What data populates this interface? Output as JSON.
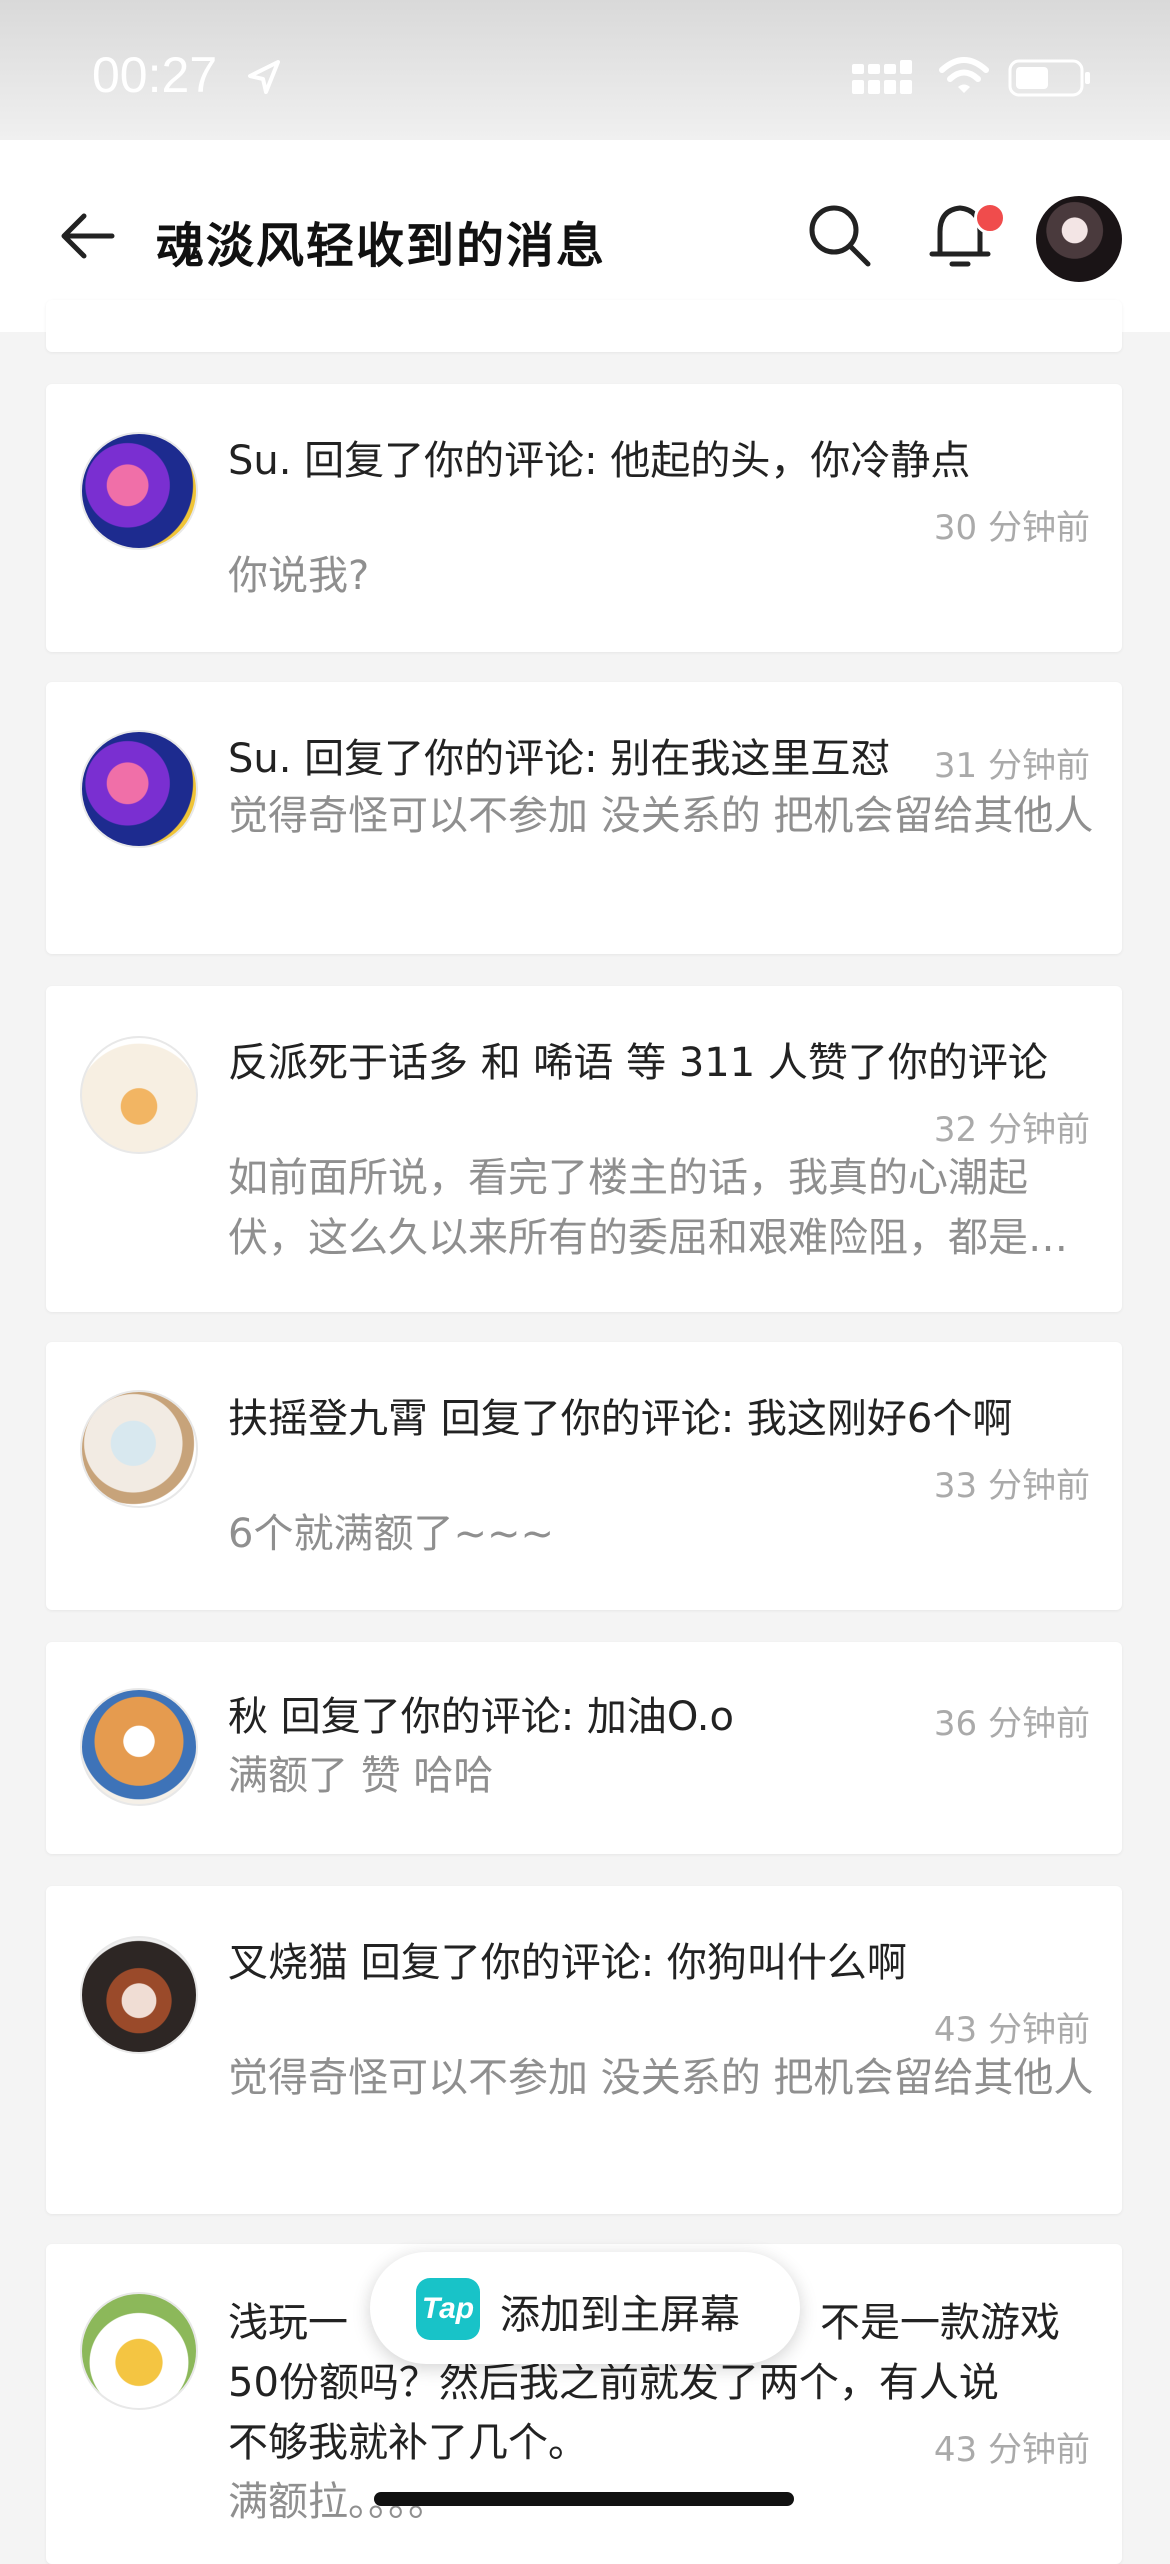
{
  "status_bar": {
    "time": "00:27"
  },
  "header": {
    "title": "魂淡风轻收到的消息"
  },
  "messages": [
    {
      "title": "Su. 回复了你的评论: 他起的头，你冷静点",
      "time": "30 分钟前",
      "body": "你说我?"
    },
    {
      "title": "Su. 回复了你的评论: 别在我这里互怼",
      "time": "31 分钟前",
      "body": "觉得奇怪可以不参加 没关系的 把机会留给其他人"
    },
    {
      "title": "反派死于话多 和 唏语 等 311 人赞了你的评论",
      "time": "32 分钟前",
      "body": "如前面所说，看完了楼主的话，我真的心潮起伏，这么久以来所有的委屈和艰难险阻，都是值得的"
    },
    {
      "title": "扶摇登九霄 回复了你的评论: 我这刚好6个啊",
      "time": "33 分钟前",
      "body": "6个就满额了~~~"
    },
    {
      "title": "秋 回复了你的评论: 加油O.o",
      "time": "36 分钟前",
      "body": "满额了 赞 哈哈"
    },
    {
      "title": "叉烧猫 回复了你的评论: 你狗叫什么啊",
      "time": "43 分钟前",
      "body": "觉得奇怪可以不参加 没关系的 把机会留给其他人"
    },
    {
      "title_line1": "浅玩一",
      "title_line1_tail": "不是一款游戏",
      "title_line2": "50份额吗？然后我之前就发了两个，有人说",
      "title_line3": "不够我就补了几个。",
      "time": "43 分钟前",
      "body": "满额拉。。。。"
    }
  ],
  "toast": {
    "label": "添加到主屏幕",
    "logo_text": "Tap"
  },
  "colors": {
    "badge": "#f04c4c",
    "tap_brand": "#18c3c8"
  }
}
